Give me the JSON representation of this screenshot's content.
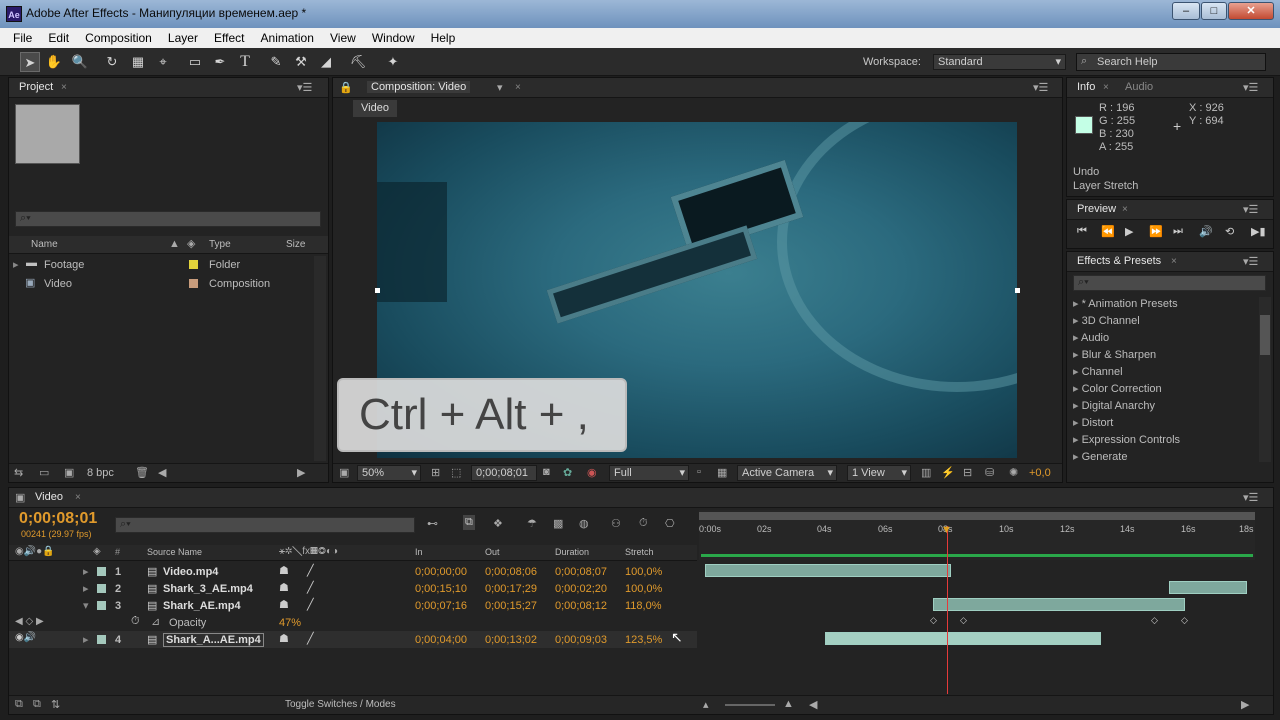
{
  "window": {
    "app_icon": "Ae",
    "title": "Adobe After Effects - Манипуляции временем.aep *",
    "controls": [
      "–",
      "□",
      "✕"
    ]
  },
  "menu": [
    "File",
    "Edit",
    "Composition",
    "Layer",
    "Effect",
    "Animation",
    "View",
    "Window",
    "Help"
  ],
  "toolbar": {
    "tools": [
      "➤",
      "✋",
      "🔍",
      "↻",
      "▦",
      "⌖",
      "▭",
      "✒",
      "T",
      "✎",
      "⚒",
      "◢",
      "⛏",
      "✦"
    ],
    "workspace_label": "Workspace:",
    "workspace_value": "Standard",
    "search_placeholder": "Search Help"
  },
  "project": {
    "tab": "Project",
    "cols": {
      "name": "Name",
      "type": "Type",
      "size": "Size"
    },
    "items": [
      {
        "name": "Footage",
        "type": "Folder",
        "color": "#e2d33b"
      },
      {
        "name": "Video",
        "type": "Composition",
        "color": "#c89c7c"
      }
    ],
    "bpc": "8 bpc"
  },
  "composition": {
    "tab": "Composition: Video",
    "name_tab": "Video",
    "overlay_text": "Ctrl + Alt + ,",
    "zoom": "50%",
    "timecode": "0;00;08;01",
    "resolution": "Full",
    "camera": "Active Camera",
    "views": "1 View",
    "exposure": "+0,0"
  },
  "info": {
    "tab_info": "Info",
    "tab_audio": "Audio",
    "r": "R : 196",
    "g": "G : 255",
    "b": "B : 230",
    "a": "A : 255",
    "x": "X : 926",
    "y": "Y : 694",
    "swatch": "#c4ffe6",
    "undo_title": "Undo",
    "undo_action": "Layer Stretch"
  },
  "preview": {
    "tab": "Preview"
  },
  "effects": {
    "tab": "Effects & Presets",
    "items": [
      "* Animation Presets",
      "3D Channel",
      "Audio",
      "Blur & Sharpen",
      "Channel",
      "Color Correction",
      "Digital Anarchy",
      "Distort",
      "Expression Controls",
      "Generate"
    ]
  },
  "timeline": {
    "tab": "Video",
    "timecode": "0;00;08;01",
    "frames": "00241 (29.97 fps)",
    "col_source": "Source Name",
    "col_in": "In",
    "col_out": "Out",
    "col_duration": "Duration",
    "col_stretch": "Stretch",
    "ruler": [
      "0:00s",
      "02s",
      "04s",
      "06s",
      "08s",
      "10s",
      "12s",
      "14s",
      "16s",
      "18s"
    ],
    "layers": [
      {
        "num": "1",
        "name": "Video.mp4",
        "in": "0;00;00;00",
        "out": "0;00;08;06",
        "dur": "0;00;08;07",
        "stretch": "100,0%"
      },
      {
        "num": "2",
        "name": "Shark_3_AE.mp4",
        "in": "0;00;15;10",
        "out": "0;00;17;29",
        "dur": "0;00;02;20",
        "stretch": "100,0%"
      },
      {
        "num": "3",
        "name": "Shark_AE.mp4",
        "in": "0;00;07;16",
        "out": "0;00;15;27",
        "dur": "0;00;08;12",
        "stretch": "118,0%"
      },
      {
        "num": "4",
        "name": "Shark_A...AE.mp4",
        "in": "0;00;04;00",
        "out": "0;00;13;02",
        "dur": "0;00;09;03",
        "stretch": "123,5%"
      }
    ],
    "opacity_label": "Opacity",
    "opacity_value": "47%",
    "toggle_label": "Toggle Switches / Modes"
  }
}
